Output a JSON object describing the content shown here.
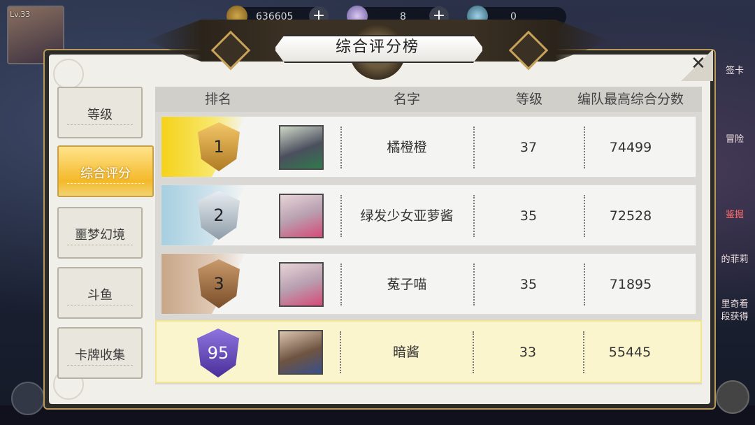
{
  "hud": {
    "level": "Lv.33",
    "gold": "636605",
    "gems": "8",
    "tickets": "0",
    "side_labels": [
      "签卡",
      "冒险",
      "鉴掘",
      "的菲莉",
      "里奇看",
      "段获得"
    ]
  },
  "title": "综合评分榜",
  "tabs": [
    {
      "label": "等级",
      "active": false
    },
    {
      "label": "综合评分",
      "active": true
    },
    {
      "label": "噩梦幻境",
      "active": false
    },
    {
      "label": "斗鱼",
      "active": false
    },
    {
      "label": "卡牌收集",
      "active": false
    }
  ],
  "table": {
    "headers": {
      "rank": "排名",
      "name": "名字",
      "level": "等级",
      "score": "编队最高综合分数"
    },
    "rows": [
      {
        "rank": "1",
        "name": "橘橙橙",
        "level": "37",
        "score": "74499",
        "badge": "gold",
        "portrait": "boy-dark-hair"
      },
      {
        "rank": "2",
        "name": "绿发少女亚萝酱",
        "level": "35",
        "score": "72528",
        "badge": "silver",
        "portrait": "girl-horns-top-star"
      },
      {
        "rank": "3",
        "name": "菟子喵",
        "level": "35",
        "score": "71895",
        "badge": "bronze",
        "portrait": "girl-horns-top-star"
      }
    ],
    "self_row": {
      "rank": "95",
      "name": "暗酱",
      "level": "33",
      "score": "55445",
      "badge": "purple",
      "portrait": "girl-brown-hair"
    }
  },
  "colors": {
    "gold": "#e9b21f",
    "silver": "#a9b7c3",
    "bronze": "#b07a52",
    "purple": "#6a4fc0",
    "active_tab": "#f4b92a",
    "self_row_bg": "#faf5cc"
  }
}
